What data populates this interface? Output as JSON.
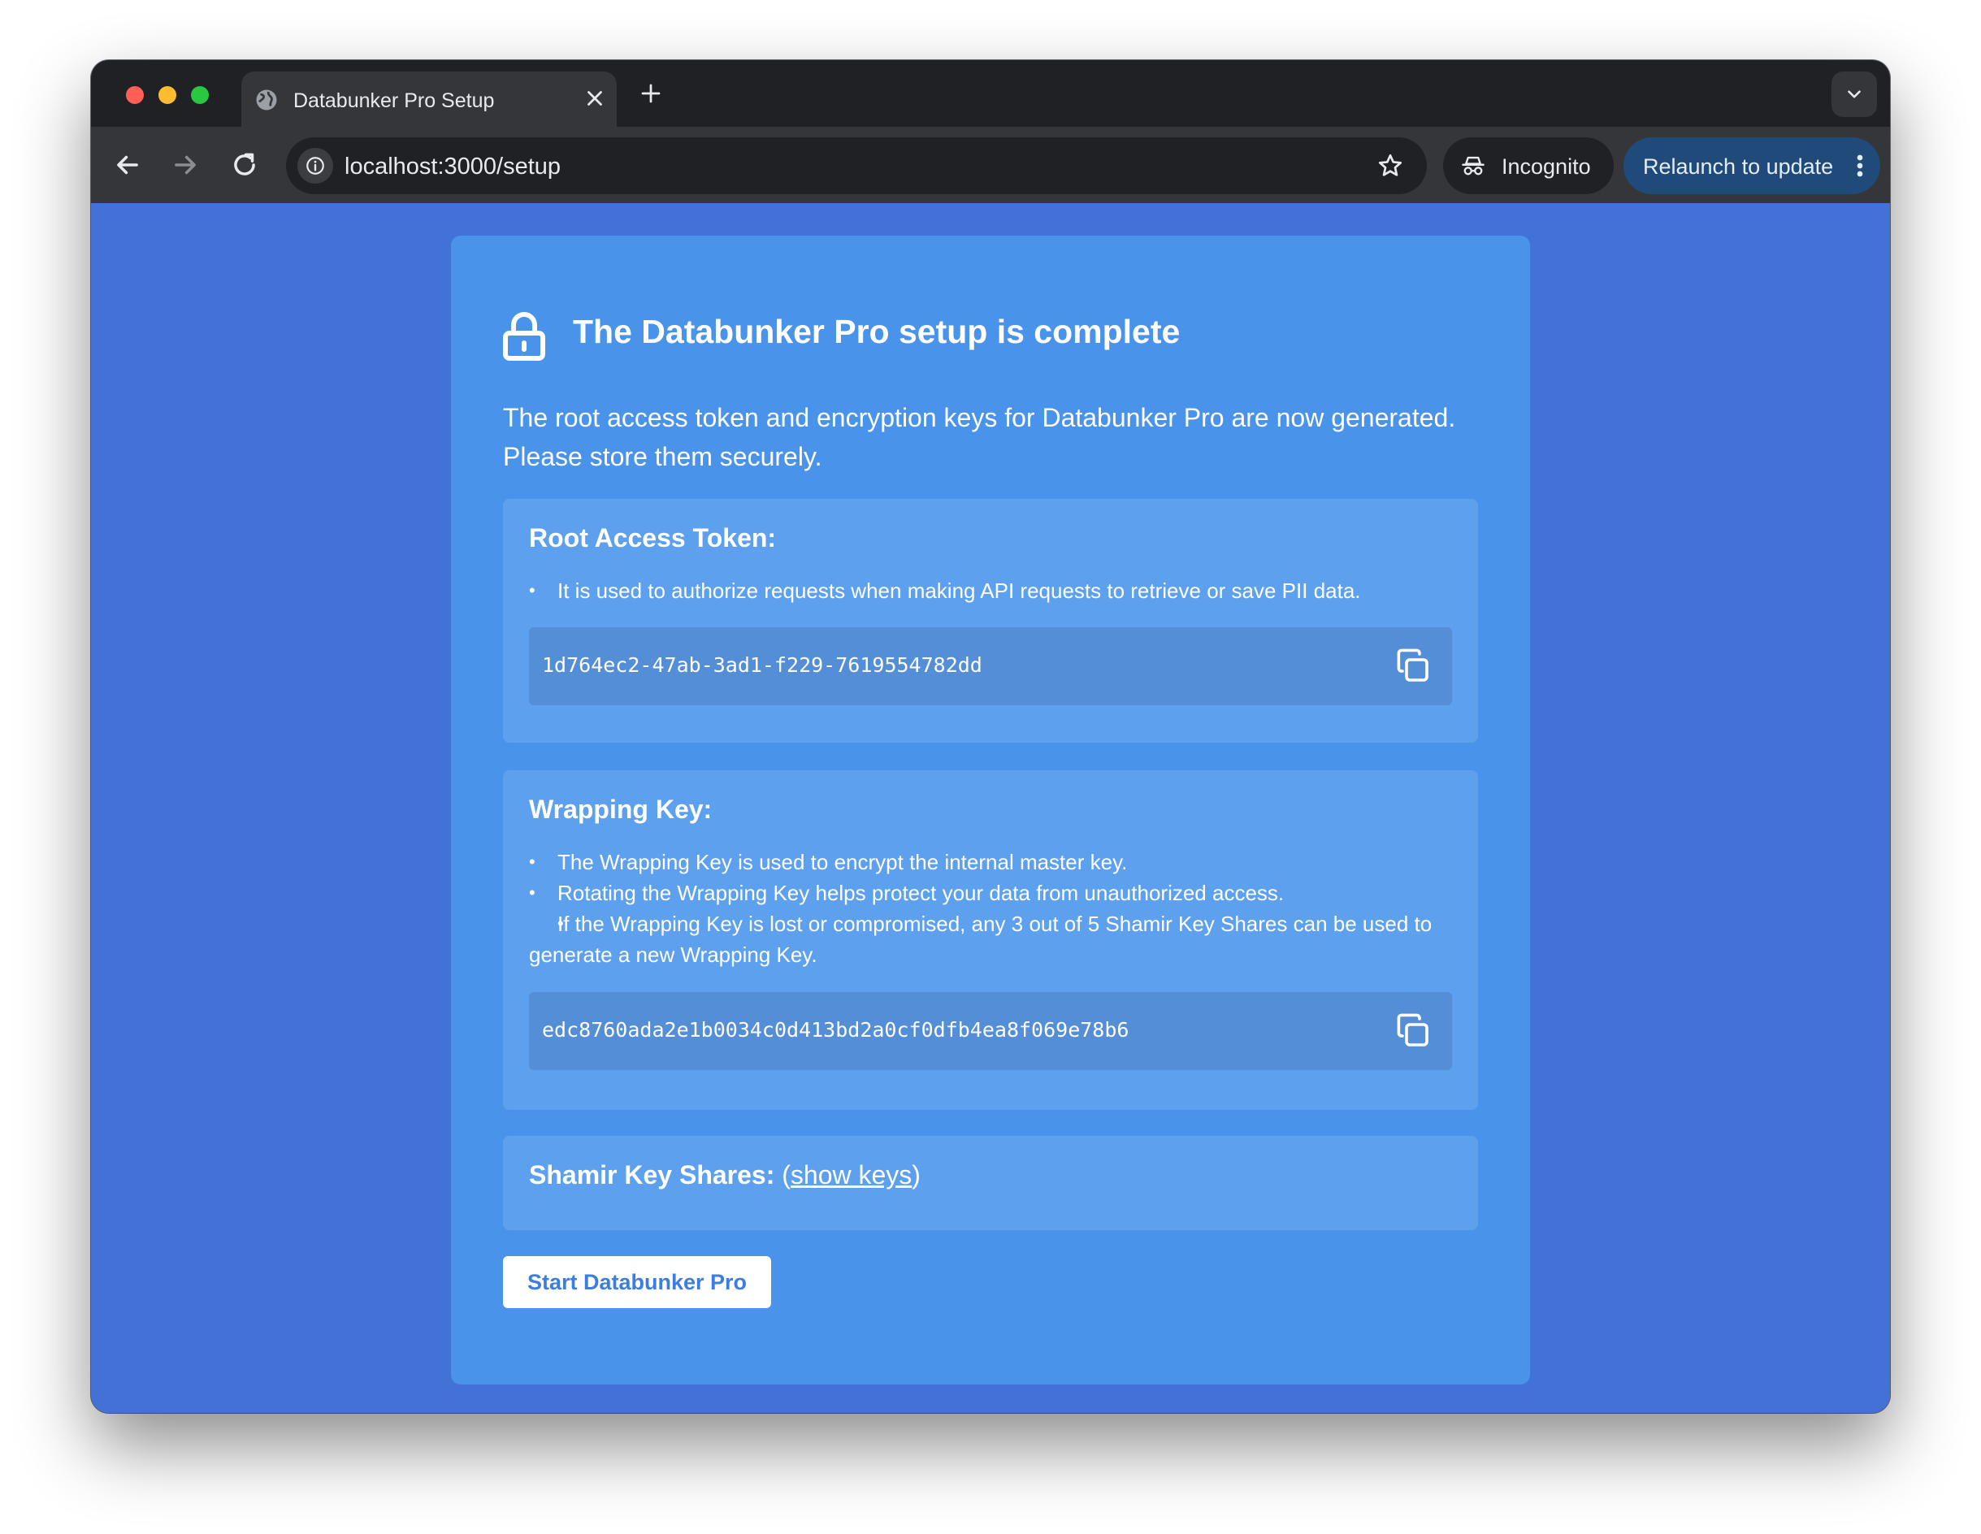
{
  "browser": {
    "tab_title": "Databunker Pro Setup",
    "url": "localhost:3000/setup",
    "incognito_label": "Incognito",
    "relaunch_label": "Relaunch to update"
  },
  "icons": {
    "tab_favicon": "globe-icon",
    "tab_close": "close-icon",
    "new_tab": "plus-icon",
    "tab_menu": "chevron-down-icon",
    "back": "arrow-left-icon",
    "forward": "arrow-right-icon",
    "reload": "reload-icon",
    "site_info": "info-icon",
    "bookmark": "star-icon",
    "incognito": "incognito-icon",
    "menu": "more-vertical-icon",
    "title": "lock-icon",
    "copy": "copy-icon"
  },
  "colors": {
    "page_background": "#4272d6",
    "card_background": "#4993eb",
    "panel_background": "#5da1ee",
    "keybox_background": "#548ed6",
    "button_text": "#3b7de0"
  },
  "setup": {
    "title": "The Databunker Pro setup is complete",
    "intro": "The root access token and encryption keys for Databunker Pro are now generated. Please store them securely.",
    "root_token": {
      "heading": "Root Access Token:",
      "bullets": [
        "It is used to authorize requests when making API requests to retrieve or save PII data."
      ],
      "value": "1d764ec2-47ab-3ad1-f229-7619554782dd"
    },
    "wrapping_key": {
      "heading": "Wrapping Key:",
      "bullets": [
        "The Wrapping Key is used to encrypt the internal master key.",
        "Rotating the Wrapping Key helps protect your data from unauthorized access.",
        "If the Wrapping Key is lost or compromised, any 3 out of 5 Shamir Key Shares can be used to generate a new Wrapping Key."
      ],
      "value": "edc8760ada2e1b0034c0d413bd2a0cf0dfb4ea8f069e78b6"
    },
    "shamir": {
      "heading": "Shamir Key Shares:",
      "open_paren": " (",
      "link_label": "show keys",
      "close_paren": ")"
    },
    "start_button": "Start Databunker Pro"
  }
}
